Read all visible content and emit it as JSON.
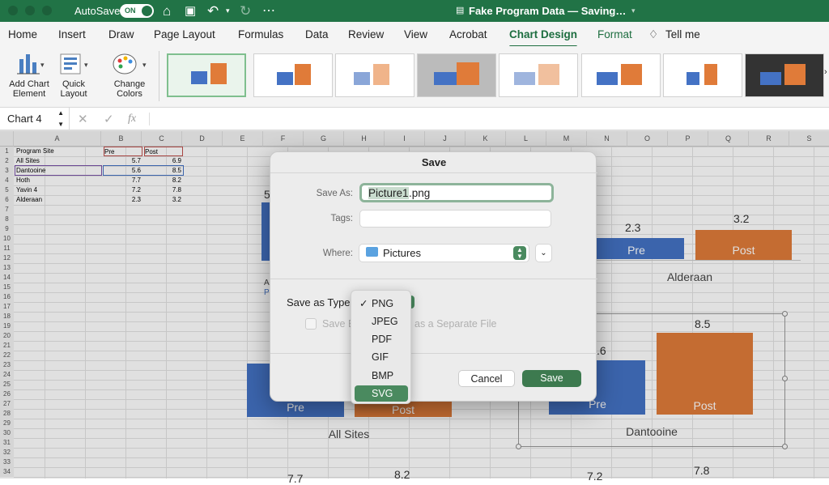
{
  "titlebar": {
    "autosave": "AutoSave",
    "autosave_state": "ON",
    "doc_title": "Fake Program Data — Saving…"
  },
  "tabs": [
    "Home",
    "Insert",
    "Draw",
    "Page Layout",
    "Formulas",
    "Data",
    "Review",
    "View",
    "Acrobat",
    "Chart Design",
    "Format",
    "Tell me"
  ],
  "ribbon": {
    "add_chart": "Add Chart Element",
    "quick_layout": "Quick Layout",
    "change_colors": "Change Colors"
  },
  "formula": {
    "name_box": "Chart 4",
    "fx": "fx"
  },
  "columns": [
    "A",
    "B",
    "C",
    "D",
    "E",
    "F",
    "G",
    "H",
    "I",
    "J",
    "K",
    "L",
    "M",
    "N",
    "O",
    "P",
    "Q",
    "R",
    "S"
  ],
  "rows": [
    "1",
    "2",
    "3",
    "4",
    "5",
    "6",
    "7",
    "8",
    "9",
    "10",
    "11",
    "12",
    "13",
    "14",
    "15",
    "16",
    "17",
    "18",
    "19",
    "20",
    "21",
    "22",
    "23",
    "24",
    "25",
    "26",
    "27",
    "28",
    "29",
    "30",
    "31",
    "32",
    "33",
    "34"
  ],
  "table": {
    "headers": [
      "Program Site",
      "Pre",
      "Post"
    ],
    "rows": [
      {
        "site": "All Sites",
        "pre": "5.7",
        "post": "6.9"
      },
      {
        "site": "Dantooine",
        "pre": "5.6",
        "post": "8.5"
      },
      {
        "site": "Hoth",
        "pre": "7.7",
        "post": "8.2"
      },
      {
        "site": "Yavin 4",
        "pre": "7.2",
        "post": "7.8"
      },
      {
        "site": "Alderaan",
        "pre": "2.3",
        "post": "3.2"
      }
    ]
  },
  "charts": {
    "alderaan": {
      "name": "Alderaan",
      "pre": "2.3",
      "post": "3.2"
    },
    "dantooine": {
      "name": "Dantooine",
      "pre_partial": ".6",
      "post": "8.5"
    },
    "allsites": {
      "name": "All Sites"
    },
    "bottom": {
      "v1": "7.7",
      "v2": "8.2",
      "v3": "7.2",
      "v4": "7.8"
    },
    "bar_pre": "Pre",
    "bar_post": "Post",
    "partial_5": "5",
    "partial_a": "A",
    "partial_p": "P"
  },
  "colors": {
    "pre": "#4472c4",
    "post": "#e07b39",
    "accent": "#217346"
  },
  "dialog": {
    "title": "Save",
    "save_as_label": "Save As:",
    "filename_selected": "Picture1",
    "filename_ext": ".png",
    "tags_label": "Tags:",
    "where_label": "Where:",
    "where_value": "Pictures",
    "type_label": "Save as Type",
    "separate_pre": "Save E",
    "separate_post": "as a Separate File",
    "cancel": "Cancel",
    "save": "Save"
  },
  "type_menu": {
    "items": [
      "PNG",
      "JPEG",
      "PDF",
      "GIF",
      "BMP",
      "SVG"
    ],
    "checked": "PNG",
    "highlighted": "SVG"
  }
}
